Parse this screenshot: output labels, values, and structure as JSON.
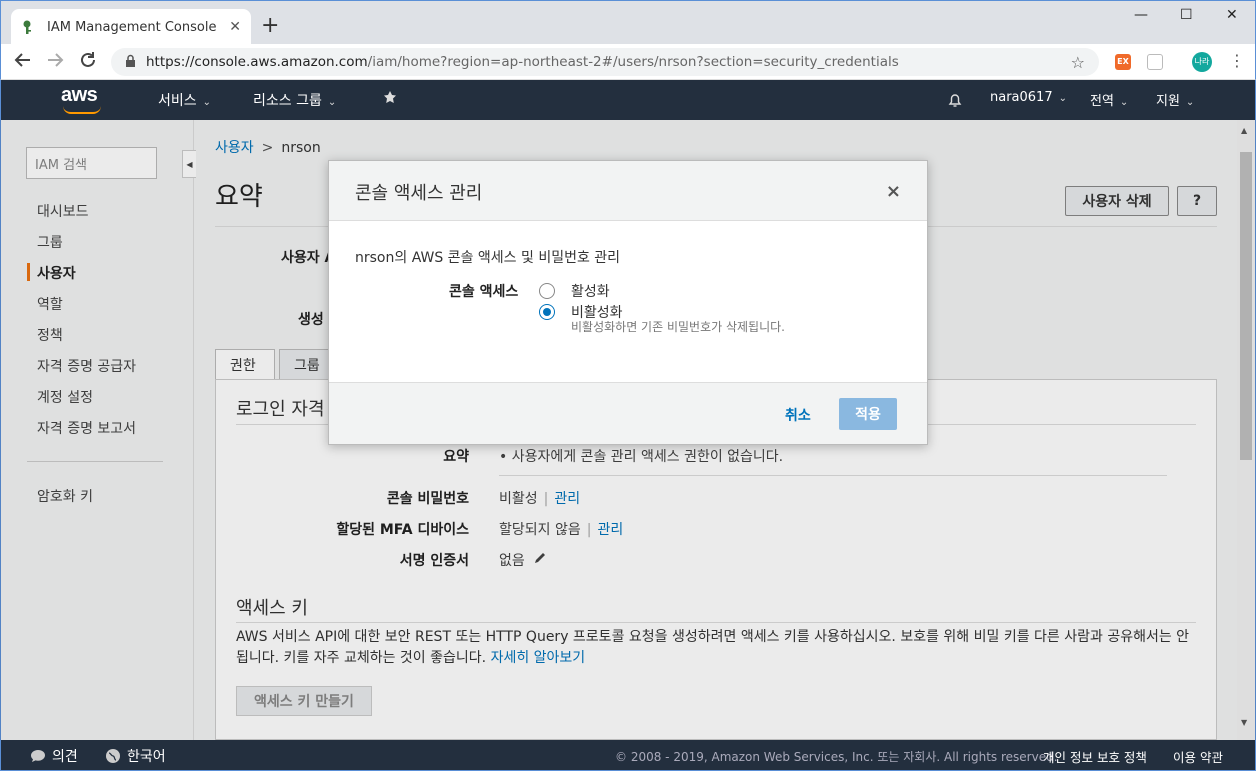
{
  "browser": {
    "tab_title": "IAM Management Console",
    "tab_close": "✕",
    "new_tab": "+",
    "url_host": "https://console.aws.amazon.com",
    "url_path": "/iam/home?region=ap-northeast-2#/users/nrson?section=security_credentials",
    "ext1": "EX",
    "profile": "나라",
    "win_min": "—",
    "win_max": "☐",
    "win_close": "✕"
  },
  "awsnav": {
    "logo": "aws",
    "services": "서비스",
    "resource_groups": "리소스 그룹",
    "user": "nara0617",
    "region": "전역",
    "support": "지원"
  },
  "sidebar": {
    "search_placeholder": "IAM 검색",
    "items": [
      "대시보드",
      "그룹",
      "사용자",
      "역할",
      "정책",
      "자격 증명 공급자",
      "계정 설정",
      "자격 증명 보고서"
    ],
    "encryption": "암호화 키"
  },
  "main": {
    "breadcrumb_users": "사용자",
    "breadcrumb_sep": ">",
    "breadcrumb_user": "nrson",
    "title": "요약",
    "delete_user": "사용자 삭제",
    "help": "?",
    "label_user": "사용자 A",
    "label_created": "생성",
    "tab_permissions": "권한",
    "tab_groups": "그룹",
    "login_section": "로그인 자격",
    "summary_label": "요약",
    "summary_value": "• 사용자에게 콘솔 관리 액세스 권한이 없습니다.",
    "console_pw_label": "콘솔 비밀번호",
    "console_pw_value": "비활성",
    "manage": "관리",
    "pipe": "|",
    "mfa_label_pre": "할당된 ",
    "mfa_label_bold": "MFA",
    "mfa_label_post": " 디바이스",
    "mfa_value": "할당되지 않음",
    "cert_label": "서명 인증서",
    "cert_value": "없음",
    "access_key_section": "액세스 키",
    "access_key_para": "AWS 서비스 API에 대한 보안 REST 또는 HTTP Query 프로토콜 요청을 생성하려면 액세스 키를 사용하십시오. 보호를 위해 비밀 키를 다른 사람과 공유해서는 안 됩니다. 키를 자주 교체하는 것이 좋습니다.",
    "learn_more": "자세히 알아보기",
    "create_key": "액세스 키 만들기"
  },
  "modal": {
    "title": "콘솔 액세스 관리",
    "close": "×",
    "desc": "nrson의 AWS 콘솔 액세스 및 비밀번호 관리",
    "radio_label": "콘솔 액세스",
    "opt_enable": "활성화",
    "opt_disable": "비활성화",
    "selected": "비활성화",
    "help": "비활성화하면 기존 비밀번호가 삭제됩니다.",
    "cancel": "취소",
    "apply": "적용"
  },
  "footer": {
    "feedback": "의견",
    "language": "한국어",
    "copyright": "© 2008 - 2019, Amazon Web Services, Inc. 또는 자회사. All rights reserved.",
    "privacy": "개인 정보 보호 정책",
    "terms": "이용 약관"
  }
}
